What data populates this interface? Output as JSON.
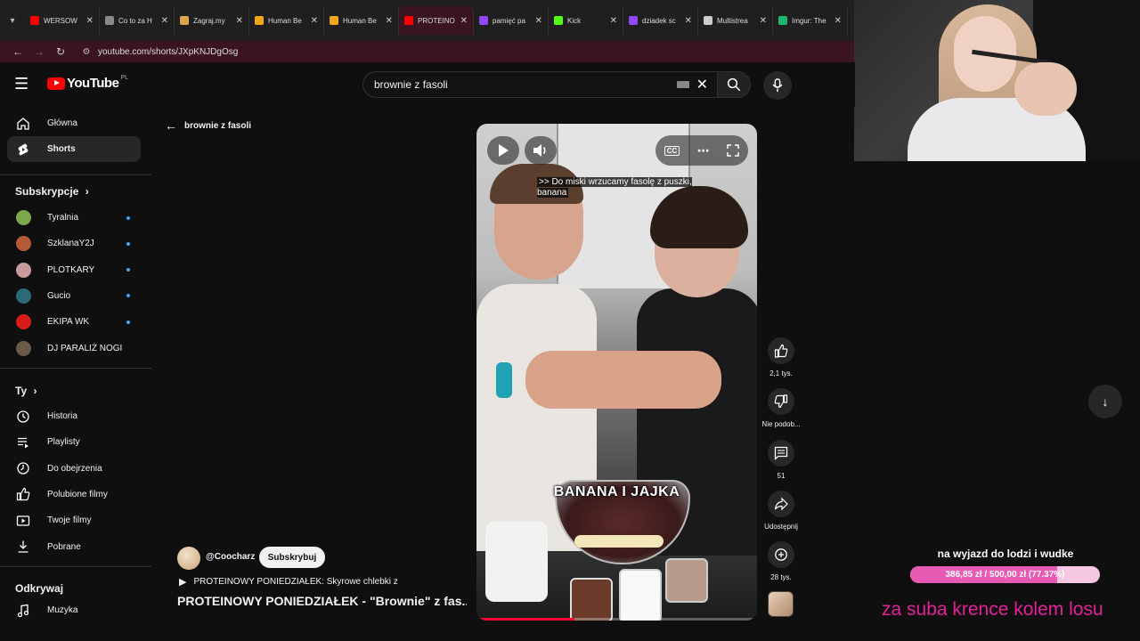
{
  "browser": {
    "tabs": [
      {
        "label": "WERSOW",
        "color": "#ff0000"
      },
      {
        "label": "Co to za H",
        "color": "#888888"
      },
      {
        "label": "Zagraj.my",
        "color": "#d9a64a"
      },
      {
        "label": "Human Be",
        "color": "#f2a51a"
      },
      {
        "label": "Human Be",
        "color": "#f2a51a"
      },
      {
        "label": "PROTEINO",
        "color": "#ff0000"
      },
      {
        "label": "pamięć pa",
        "color": "#9146ff"
      },
      {
        "label": "Kick",
        "color": "#53fc18"
      },
      {
        "label": "dziadek sc",
        "color": "#9146ff"
      },
      {
        "label": "Multistrea",
        "color": "#cccccc"
      },
      {
        "label": "Imgur: The",
        "color": "#1bb76e"
      }
    ],
    "active_tab_index": 5,
    "url": "youtube.com/shorts/JXpKNJDgOsg"
  },
  "header": {
    "logo_text": "YouTube",
    "country_code": "PL",
    "search_value": "brownie z fasoli"
  },
  "sidebar": {
    "main": [
      {
        "label": "Główna",
        "icon": "home-icon"
      },
      {
        "label": "Shorts",
        "icon": "shorts-icon"
      }
    ],
    "subscriptions_title": "Subskrypcje",
    "subscriptions": [
      {
        "label": "Tyralnia",
        "color": "#7aa84a",
        "new": true
      },
      {
        "label": "SzklanaY2J",
        "color": "#b85a3a",
        "new": true
      },
      {
        "label": "PLOTKARY",
        "color": "#c89a9a",
        "new": true
      },
      {
        "label": "Gucio",
        "color": "#2a6a7a",
        "new": true
      },
      {
        "label": "EKIPA WK",
        "color": "#d81b1b",
        "new": true
      },
      {
        "label": "DJ PARALIŻ NOGI",
        "color": "#6a5a4a",
        "new": false
      }
    ],
    "you_title": "Ty",
    "you": [
      {
        "label": "Historia",
        "icon": "history-icon"
      },
      {
        "label": "Playlisty",
        "icon": "playlist-icon"
      },
      {
        "label": "Do obejrzenia",
        "icon": "watch-later-icon"
      },
      {
        "label": "Polubione filmy",
        "icon": "like-icon"
      },
      {
        "label": "Twoje filmy",
        "icon": "your-videos-icon"
      },
      {
        "label": "Pobrane",
        "icon": "download-icon"
      }
    ],
    "explore_title": "Odkrywaj",
    "explore": [
      {
        "label": "Muzyka",
        "icon": "music-icon"
      }
    ]
  },
  "main": {
    "back_label": "brownie z fasoli",
    "video": {
      "caption": ">> Do miski wrzucamy fasolę z puszki, banana",
      "overlay_text": "BANANA I JAJKA",
      "progress": 0.35
    },
    "actions": {
      "likes": "2,1 tys.",
      "dislike_label": "Nie podob...",
      "comments": "51",
      "share_label": "Udostępnij",
      "remix_count": "28 tys."
    },
    "channel": {
      "handle": "@Coocharz",
      "subscribe_label": "Subskrybuj"
    },
    "playlist_label": "PROTEINOWY PONIEDZIAŁEK: Skyrowe chlebki z",
    "title": "PROTEINOWY PONIEDZIAŁEK - \"Brownie\" z fas..."
  },
  "stream_overlay": {
    "goal_title": "na wyjazd do lodzi i wudke",
    "goal_text": "386,85 zł / 500,00 zł (77.37%)",
    "goal_progress": 0.7737,
    "promo_text": "za suba krence kolem losu"
  }
}
